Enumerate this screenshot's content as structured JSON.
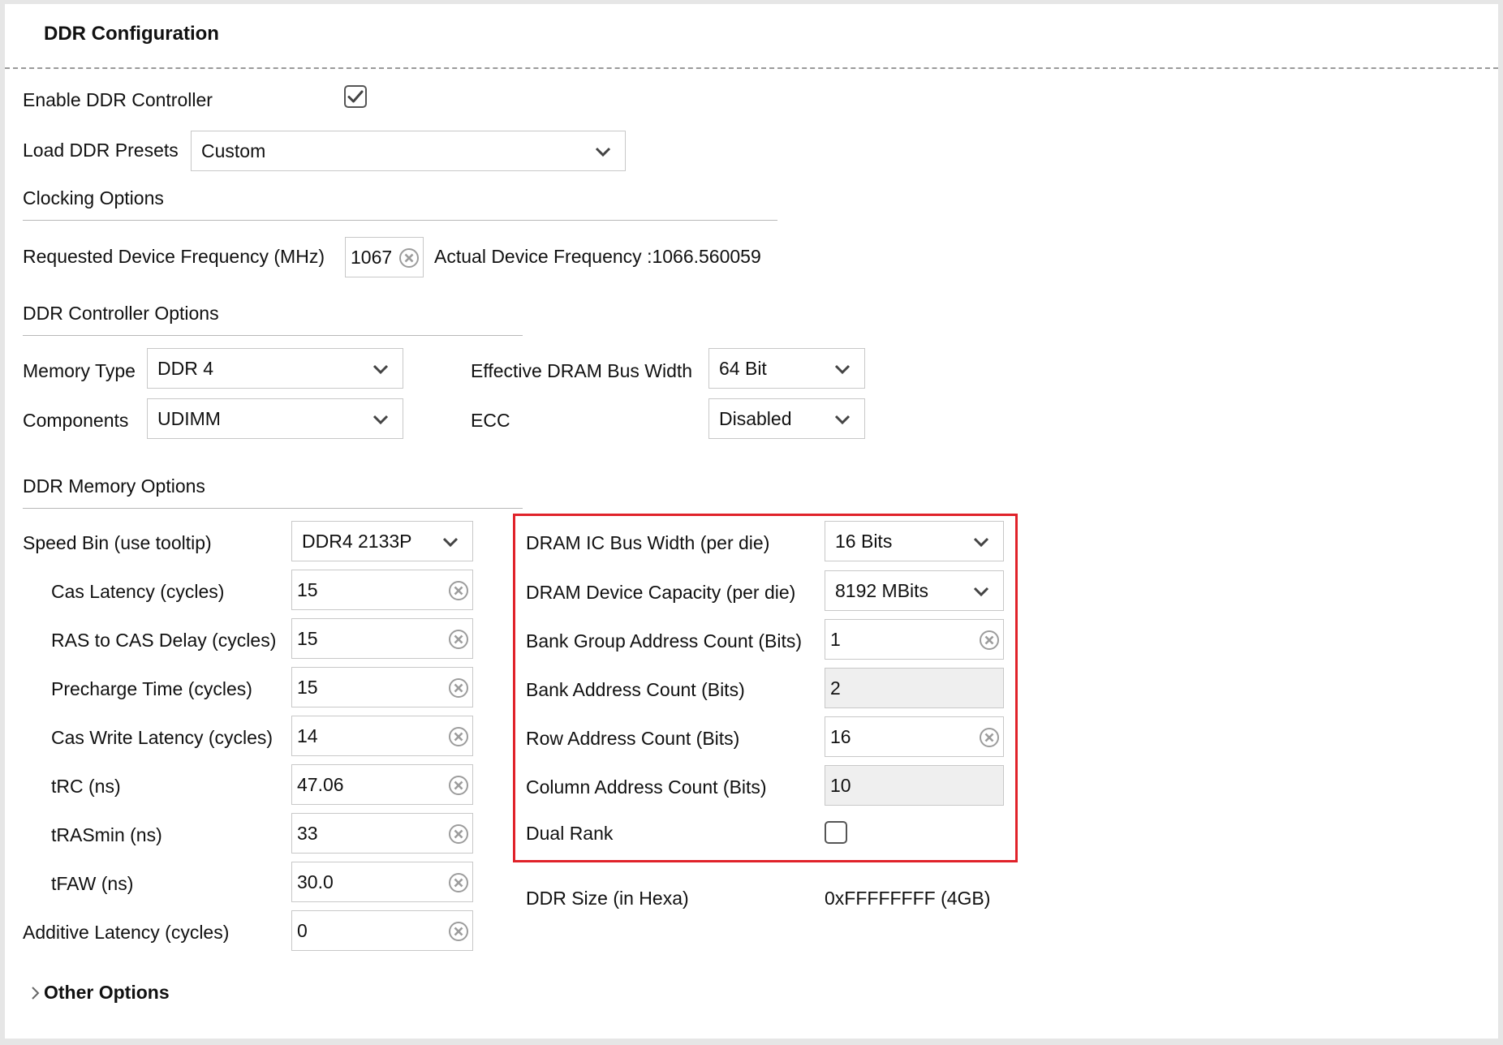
{
  "header": {
    "title": "DDR Configuration"
  },
  "general": {
    "enable_label": "Enable DDR Controller",
    "enable_checked": true,
    "presets_label": "Load DDR Presets",
    "presets_value": "Custom"
  },
  "clocking": {
    "title": "Clocking Options",
    "requested_label": "Requested Device Frequency (MHz)",
    "requested_value": "1067",
    "actual_text": "Actual Device Frequency :1066.560059"
  },
  "controller": {
    "title": "DDR Controller Options",
    "memory_type_label": "Memory Type",
    "memory_type_value": "DDR 4",
    "components_label": "Components",
    "components_value": "UDIMM",
    "bus_width_label": "Effective DRAM Bus Width",
    "bus_width_value": "64 Bit",
    "ecc_label": "ECC",
    "ecc_value": "Disabled"
  },
  "memory": {
    "title": "DDR Memory Options",
    "speed_bin_label": "Speed Bin (use tooltip)",
    "speed_bin_value": "DDR4 2133P",
    "timings": [
      {
        "label": "Cas Latency (cycles)",
        "value": "15"
      },
      {
        "label": "RAS to CAS Delay (cycles)",
        "value": "15"
      },
      {
        "label": "Precharge Time (cycles)",
        "value": "15"
      },
      {
        "label": "Cas Write Latency (cycles)",
        "value": "14"
      },
      {
        "label": "tRC (ns)",
        "value": "47.06"
      },
      {
        "label": "tRASmin (ns)",
        "value": "33"
      },
      {
        "label": "tFAW (ns)",
        "value": "30.0"
      }
    ],
    "additive_label": "Additive Latency (cycles)",
    "additive_value": "0"
  },
  "dram": {
    "ic_bus_width_label": "DRAM IC Bus Width (per die)",
    "ic_bus_width_value": "16 Bits",
    "capacity_label": "DRAM Device Capacity (per die)",
    "capacity_value": "8192 MBits",
    "bank_group_label": "Bank Group Address Count (Bits)",
    "bank_group_value": "1",
    "bank_address_label": "Bank Address Count (Bits)",
    "bank_address_value": "2",
    "row_address_label": "Row Address Count (Bits)",
    "row_address_value": "16",
    "column_address_label": "Column Address Count (Bits)",
    "column_address_value": "10",
    "dual_rank_label": "Dual Rank",
    "dual_rank_checked": false
  },
  "size": {
    "label": "DDR Size (in Hexa)",
    "value": "0xFFFFFFFF (4GB)"
  },
  "other": {
    "title": "Other Options"
  },
  "colors": {
    "highlight": "#e0222a",
    "border": "#c8c8c8",
    "readonly_bg": "#efefef"
  },
  "icons": {
    "dropdown": "chevron-down-icon",
    "clear": "clear-circle-icon",
    "expand": "chevron-right-icon",
    "check": "checkmark-icon"
  }
}
